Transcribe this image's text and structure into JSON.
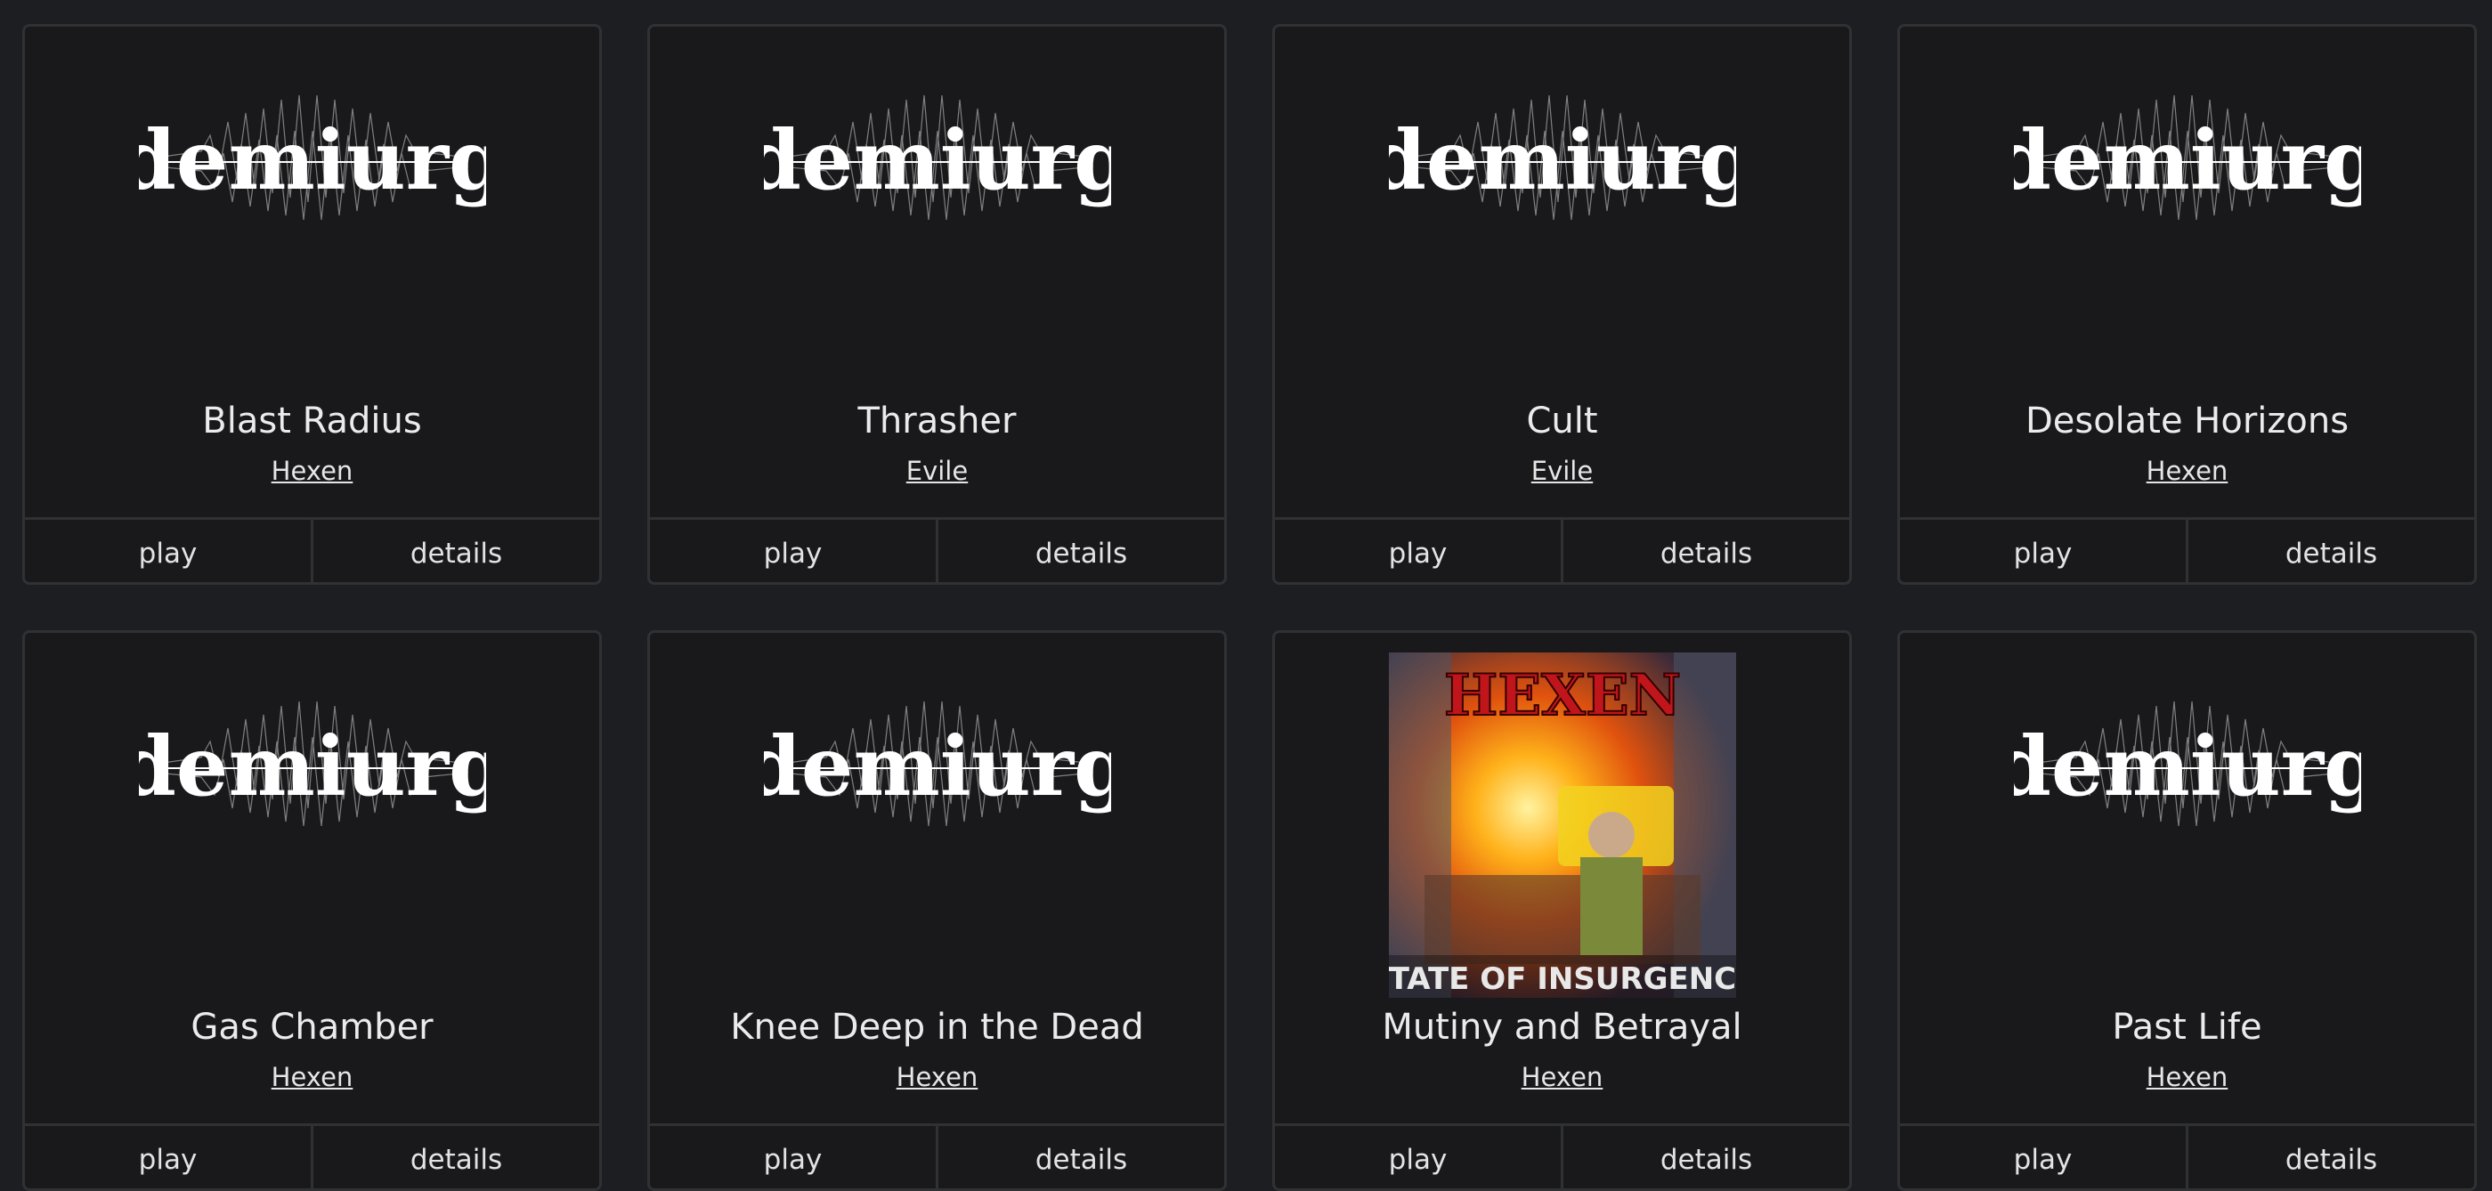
{
  "albums": [
    {
      "title": "Blast Radius",
      "artist": "Hexen",
      "cover": "demiurg-logo",
      "play_label": "play",
      "details_label": "details"
    },
    {
      "title": "Thrasher",
      "artist": "Evile",
      "cover": "demiurg-logo",
      "play_label": "play",
      "details_label": "details"
    },
    {
      "title": "Cult",
      "artist": "Evile",
      "cover": "demiurg-logo",
      "play_label": "play",
      "details_label": "details"
    },
    {
      "title": "Desolate Horizons",
      "artist": "Hexen",
      "cover": "demiurg-logo",
      "play_label": "play",
      "details_label": "details"
    },
    {
      "title": "Gas Chamber",
      "artist": "Hexen",
      "cover": "demiurg-logo",
      "play_label": "play",
      "details_label": "details"
    },
    {
      "title": "Knee Deep in the Dead",
      "artist": "Hexen",
      "cover": "demiurg-logo",
      "play_label": "play",
      "details_label": "details"
    },
    {
      "title": "Mutiny and Betrayal",
      "artist": "Hexen",
      "cover": "album-cover-art",
      "cover_band": "HEXEN",
      "cover_caption": "STATE OF INSURGENCY",
      "play_label": "play",
      "details_label": "details"
    },
    {
      "title": "Past Life",
      "artist": "Hexen",
      "cover": "demiurg-logo",
      "play_label": "play",
      "details_label": "details"
    }
  ],
  "logo_text": "demiurg",
  "colors": {
    "background": "#1d1e21",
    "card": "#19191b",
    "border": "#303133",
    "text": "#ebebeb"
  }
}
